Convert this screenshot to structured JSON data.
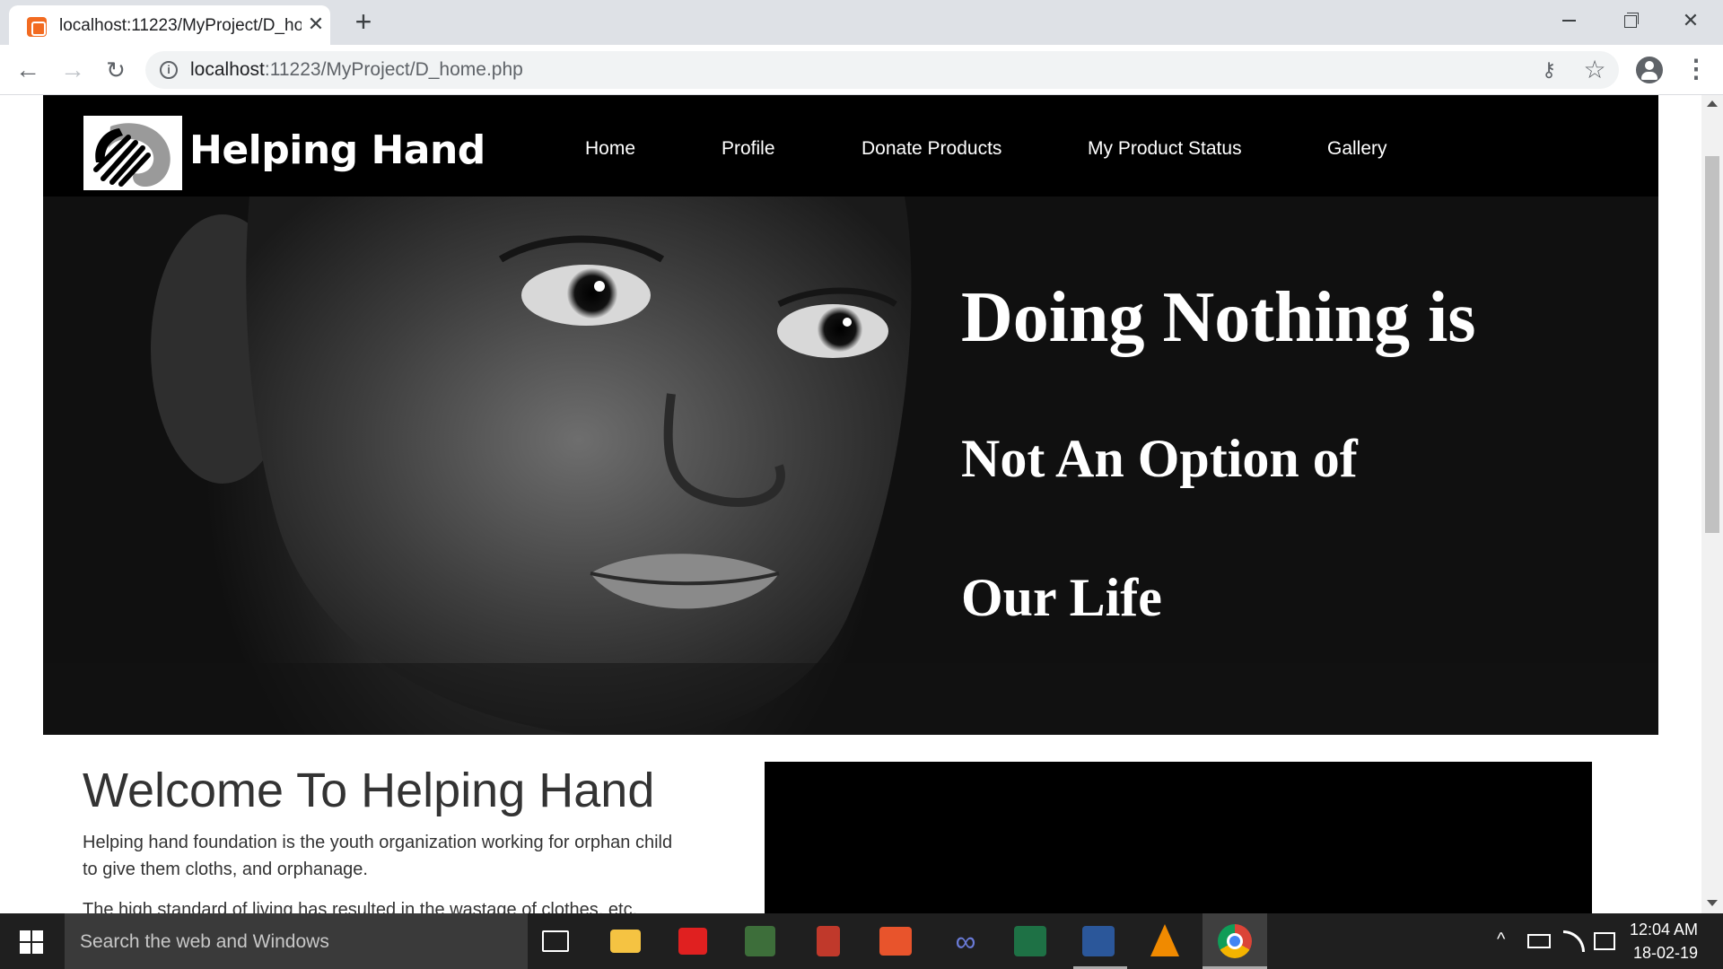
{
  "browser": {
    "tab_title": "localhost:11223/MyProject/D_ho",
    "tab_close": "✕",
    "new_tab": "+",
    "url_host": "localhost",
    "url_rest": ":11223/MyProject/D_home.php",
    "back": "←",
    "forward": "→",
    "reload": "↻",
    "info": "i",
    "key": "⚷",
    "star": "☆",
    "menu": "⋮",
    "close_window": "✕"
  },
  "site": {
    "logo_text": "Helping Hand",
    "nav": [
      "Home",
      "Profile",
      "Donate Products",
      "My Product Status",
      "Gallery"
    ],
    "hero_lines": [
      "Doing Nothing is",
      "Not An Option of",
      "Our Life"
    ],
    "welcome_title": "Welcome To Helping Hand",
    "welcome_p1": "Helping hand foundation is the youth organization working for orphan child to give them cloths, and orphanage.",
    "welcome_p2": "The high standard of living has resulted in the wastage of clothes, etc."
  },
  "taskbar": {
    "search_placeholder": "Search the web and Windows",
    "time": "12:04 AM",
    "date": "18-02-19",
    "tray_chevron": "^",
    "apps": [
      "task-view",
      "file-explorer",
      "reader",
      "snipping-tool",
      "app-red",
      "app-presentation",
      "infinity-app",
      "excel",
      "word",
      "vlc",
      "chrome"
    ]
  },
  "colors": {
    "tab_strip": "#dee1e6",
    "header_bg": "#000000",
    "taskbar_bg": "#1f1f1f",
    "favicon": "#f26b21"
  }
}
